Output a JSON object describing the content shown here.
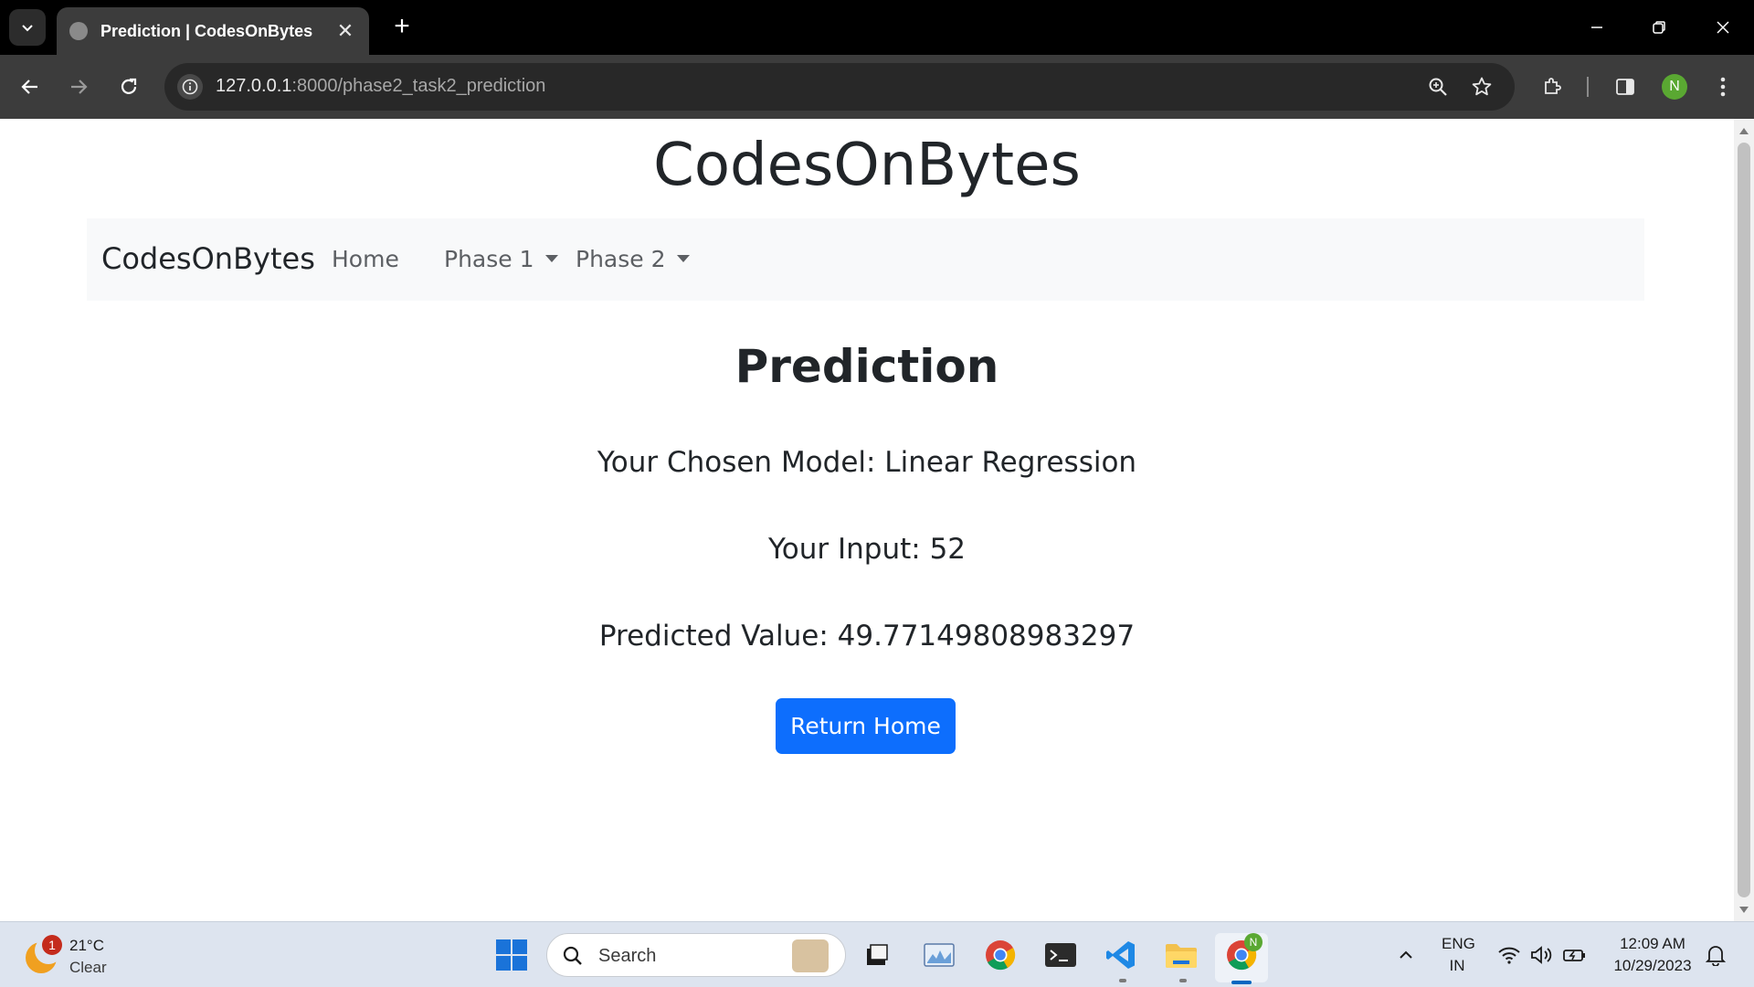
{
  "browser": {
    "tab_title": "Prediction | CodesOnBytes",
    "tab_close": "✕",
    "new_tab": "+",
    "url_host": "127.0.0.1",
    "url_path": ":8000/phase2_task2_prediction",
    "profile_initial": "N",
    "theme": {
      "tabbar": "#000000",
      "toolbar": "#3c3c3c",
      "omnibox": "#282828"
    }
  },
  "page": {
    "site_title": "CodesOnBytes",
    "brand": "CodesOnBytes",
    "nav": {
      "home": "Home",
      "phase1": "Phase 1",
      "phase2": "Phase 2"
    },
    "heading": "Prediction",
    "model_line": "Your Chosen Model: Linear Regression",
    "input_line": "Your Input: 52",
    "predicted_line": "Predicted Value: 49.77149808983297",
    "return_button": "Return Home",
    "accent_color": "#0d6efd"
  },
  "taskbar": {
    "weather_badge": "1",
    "temperature": "21°C",
    "condition": "Clear",
    "search_label": "Search",
    "language": "ENG",
    "region": "IN",
    "time": "12:09 AM",
    "date": "10/29/2023",
    "chrome_badge": "N"
  }
}
